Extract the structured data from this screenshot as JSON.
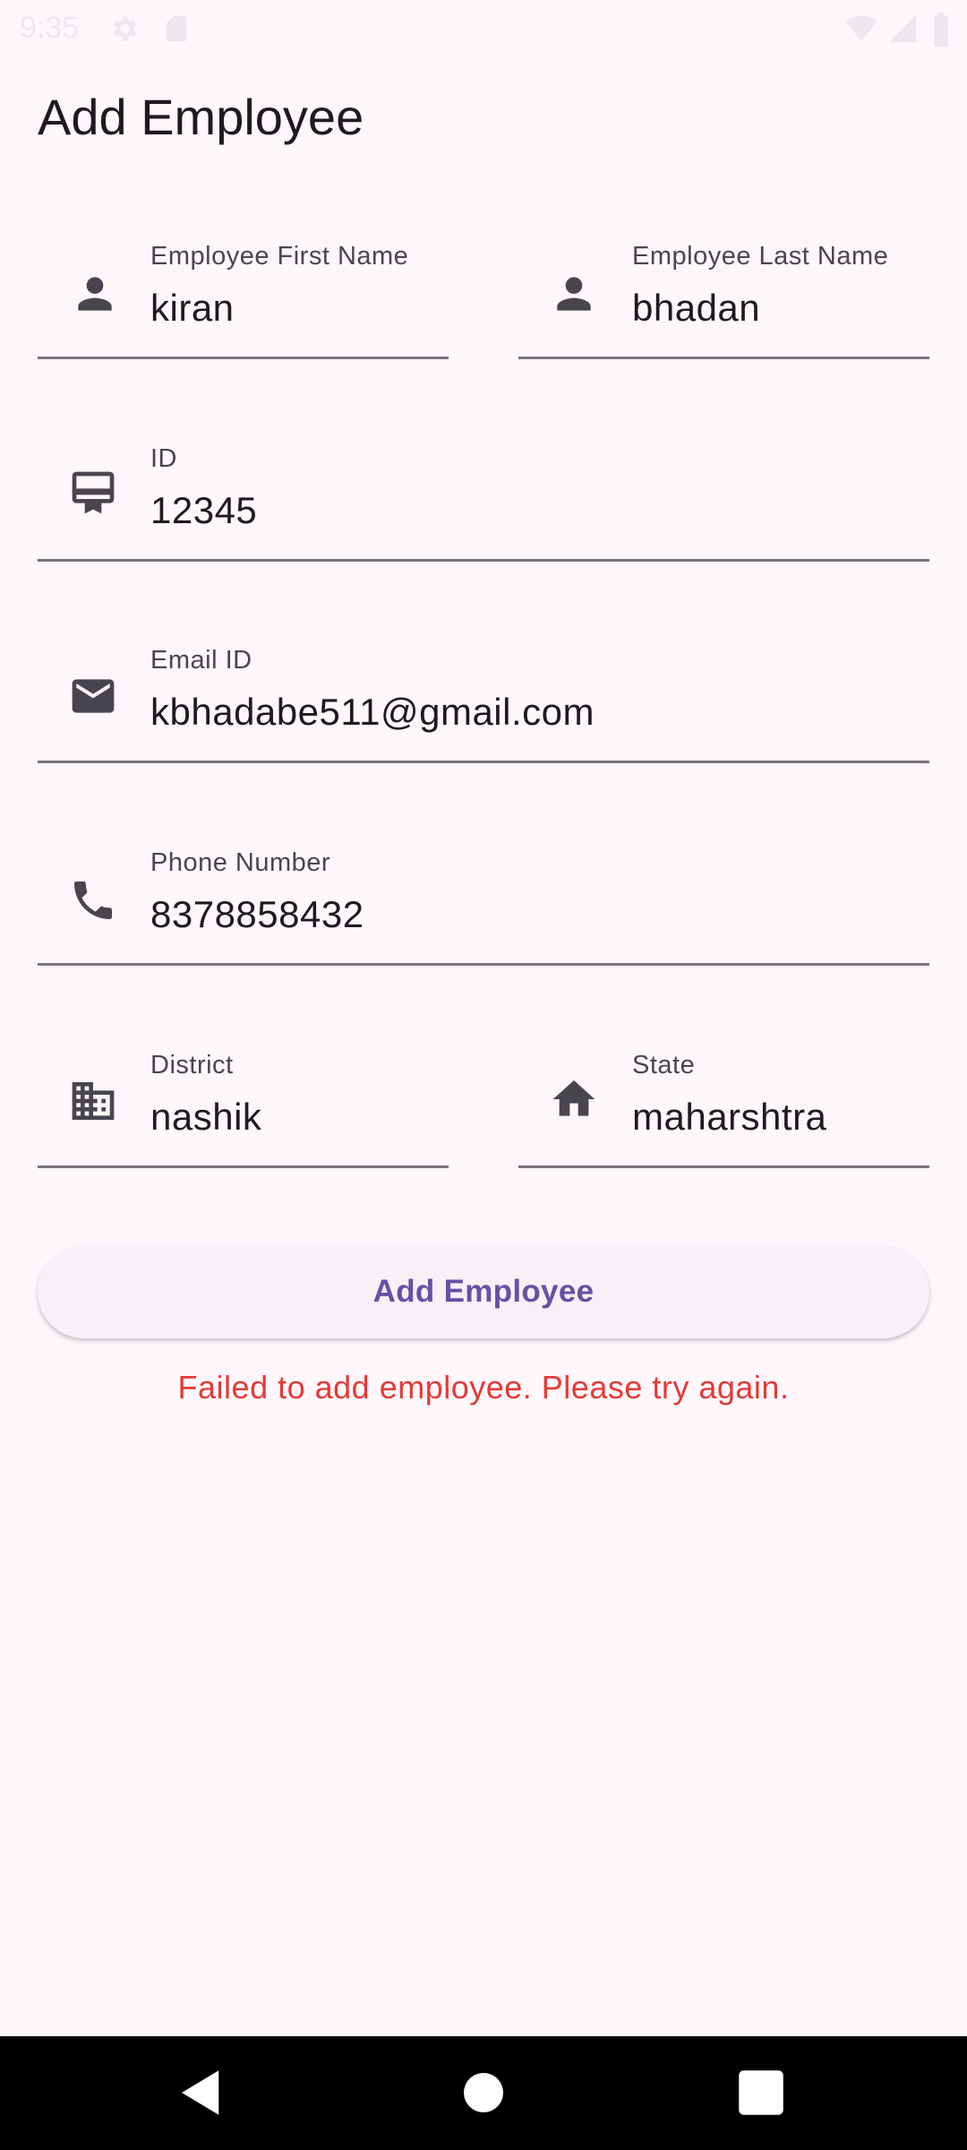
{
  "status_bar": {
    "time": "9:35"
  },
  "app_bar": {
    "title": "Add Employee"
  },
  "form": {
    "first_name": {
      "label": "Employee First Name",
      "value": "kiran",
      "icon": "person-icon"
    },
    "last_name": {
      "label": "Employee Last Name",
      "value": "bhadan",
      "icon": "person-icon"
    },
    "id": {
      "label": "ID",
      "value": "12345",
      "icon": "badge-icon"
    },
    "email": {
      "label": "Email ID",
      "value": "kbhadabe511@gmail.com",
      "icon": "mail-icon"
    },
    "phone": {
      "label": "Phone Number",
      "value": "8378858432",
      "icon": "phone-icon"
    },
    "district": {
      "label": "District",
      "value": "nashik",
      "icon": "city-icon"
    },
    "state": {
      "label": "State",
      "value": "maharshtra",
      "icon": "home-icon"
    }
  },
  "actions": {
    "submit_label": "Add Employee"
  },
  "error": {
    "message": "Failed to add employee. Please try again."
  },
  "colors": {
    "background": "#fdf7fc",
    "accent": "#6750a4",
    "error": "#e53935",
    "icon": "#49454f",
    "divider": "#79747e"
  },
  "nav": {
    "icons": [
      "back-icon",
      "home-icon",
      "recents-icon"
    ]
  }
}
